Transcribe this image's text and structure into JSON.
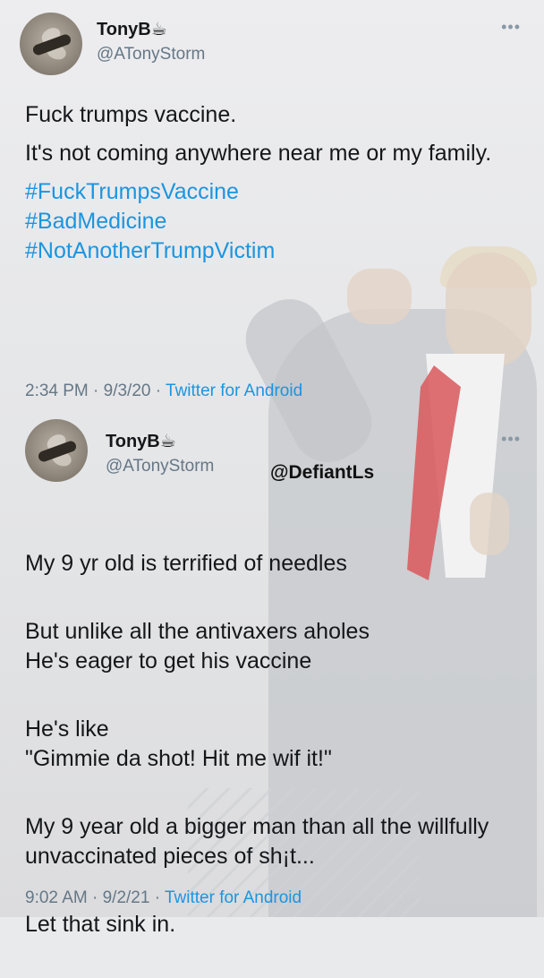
{
  "tweet1": {
    "display_name": "TonyB☕",
    "handle": "@ATonyStorm",
    "more": "•••",
    "paragraphs": [
      "Fuck trumps vaccine.",
      "It's not coming anywhere near me or my family."
    ],
    "hashtags": [
      "#FuckTrumpsVaccine",
      "#BadMedicine",
      "#NotAnotherTrumpVictim"
    ],
    "timestamp": "2:34 PM · 9/3/20 · ",
    "source": "Twitter for Android"
  },
  "tweet2": {
    "display_name": "TonyB☕",
    "handle": "@ATonyStorm",
    "more": "•••",
    "paragraphs": [
      "My 9 yr old is terrified of needles",
      "But unlike all the antivaxers aholes\nHe's eager to get his vaccine",
      "He's like\n \"Gimmie da shot!    Hit me wif it!\"",
      "My 9 year old a bigger man than all the willfully unvaccinated pieces of sh¡t...",
      "Let that sink in."
    ],
    "timestamp": "9:02 AM · 9/2/21 · ",
    "source": "Twitter for Android"
  },
  "watermark": "@DefiantLs"
}
